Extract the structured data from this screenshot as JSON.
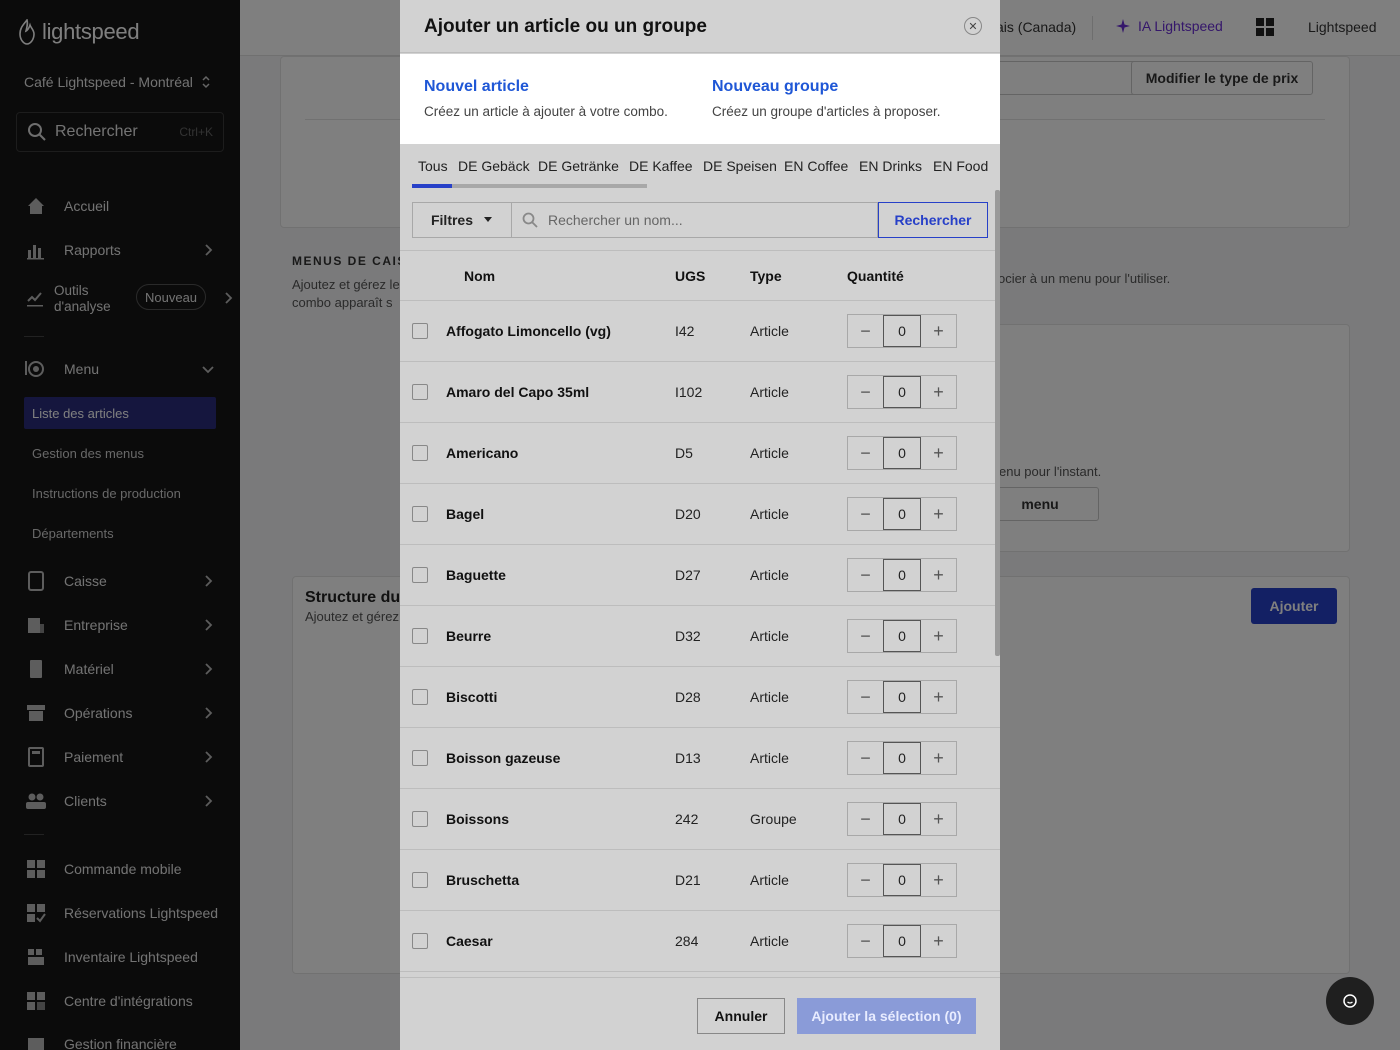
{
  "sidebar": {
    "logo_text": "lightspeed",
    "location": "Café Lightspeed - Montréal",
    "search_placeholder": "Rechercher",
    "search_shortcut": "Ctrl+K",
    "nav": {
      "accueil": "Accueil",
      "rapports": "Rapports",
      "outils_line1": "Outils",
      "outils_line2": "d'analyse",
      "outils_badge": "Nouveau",
      "menu": "Menu",
      "caisse": "Caisse",
      "entreprise": "Entreprise",
      "materiel": "Matériel",
      "operations": "Opérations",
      "paiement": "Paiement",
      "clients": "Clients",
      "commande_mobile": "Commande mobile",
      "reservations": "Réservations Lightspeed",
      "inventaire": "Inventaire Lightspeed",
      "integrations": "Centre d'intégrations",
      "gestion_financiere": "Gestion financière"
    },
    "menu_sub": {
      "liste_articles": "Liste des articles",
      "gestion_menus": "Gestion des menus",
      "instructions": "Instructions de production",
      "departements": "Départements"
    }
  },
  "topbar": {
    "language": "ais (Canada)",
    "ia": "IA Lightspeed",
    "brand": "Lightspeed"
  },
  "background": {
    "modifier_prix": "Modifier le type de prix",
    "menus_caisse_heading": "MENUS DE CAIS",
    "menus_caisse_desc1": "Ajoutez et gérez le",
    "menus_caisse_desc2": "combo apparaît s",
    "menus_caisse_right": "ocier à un menu pour l'utiliser.",
    "empty_text": "enu pour l'instant.",
    "empty_btn": "menu",
    "structure_title": "Structure du c",
    "structure_desc": "Ajoutez et gérez",
    "ajouter": "Ajouter"
  },
  "modal": {
    "title": "Ajouter un article ou un groupe",
    "close_glyph": "✕",
    "new_article": {
      "label": "Nouvel article",
      "desc": "Créez un article à ajouter à votre combo."
    },
    "new_group": {
      "label": "Nouveau groupe",
      "desc": "Créez un groupe d'articles à proposer."
    },
    "tabs": [
      "Tous",
      "DE Gebäck",
      "DE Getränke",
      "DE Kaffee",
      "DE Speisen",
      "EN Coffee",
      "EN Drinks",
      "EN Food"
    ],
    "filters_label": "Filtres",
    "search_placeholder": "Rechercher un nom...",
    "search_button": "Rechercher",
    "columns": {
      "nom": "Nom",
      "ugs": "UGS",
      "type": "Type",
      "quantite": "Quantité"
    },
    "rows": [
      {
        "nom": "Affogato Limoncello (vg)",
        "ugs": "I42",
        "type": "Article",
        "qty": "0"
      },
      {
        "nom": "Amaro del Capo 35ml",
        "ugs": "I102",
        "type": "Article",
        "qty": "0"
      },
      {
        "nom": "Americano",
        "ugs": "D5",
        "type": "Article",
        "qty": "0"
      },
      {
        "nom": "Bagel",
        "ugs": "D20",
        "type": "Article",
        "qty": "0"
      },
      {
        "nom": "Baguette",
        "ugs": "D27",
        "type": "Article",
        "qty": "0"
      },
      {
        "nom": "Beurre",
        "ugs": "D32",
        "type": "Article",
        "qty": "0"
      },
      {
        "nom": "Biscotti",
        "ugs": "D28",
        "type": "Article",
        "qty": "0"
      },
      {
        "nom": "Boisson gazeuse",
        "ugs": "D13",
        "type": "Article",
        "qty": "0"
      },
      {
        "nom": "Boissons",
        "ugs": "242",
        "type": "Groupe",
        "qty": "0"
      },
      {
        "nom": "Bruschetta",
        "ugs": "D21",
        "type": "Article",
        "qty": "0"
      },
      {
        "nom": "Caesar",
        "ugs": "284",
        "type": "Article",
        "qty": "0"
      }
    ],
    "cancel_label": "Annuler",
    "add_selection_label": "Ajouter la sélection (0)"
  },
  "colors": {
    "accent": "#2740c8",
    "link": "#1f57d6",
    "sidebar_bg": "#161616",
    "sidebar_active": "#2a2d7c",
    "ia_purple": "#6b2fd6"
  }
}
